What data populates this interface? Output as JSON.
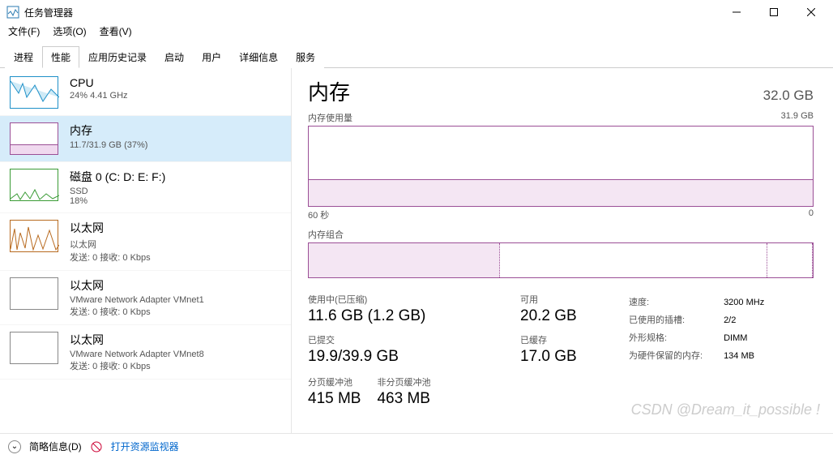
{
  "window": {
    "title": "任务管理器",
    "menu": {
      "file": "文件(F)",
      "options": "选项(O)",
      "view": "查看(V)"
    }
  },
  "tabs": [
    "进程",
    "性能",
    "应用历史记录",
    "启动",
    "用户",
    "详细信息",
    "服务"
  ],
  "activeTab": 1,
  "sidebar": [
    {
      "name": "CPU",
      "sub": "24% 4.41 GHz",
      "color": "#1e90c8"
    },
    {
      "name": "内存",
      "sub": "11.7/31.9 GB (37%)",
      "color": "#9b4f96",
      "selected": true
    },
    {
      "name": "磁盘 0 (C: D: E: F:)",
      "sub": "SSD",
      "sub2": "18%",
      "color": "#3a9b35"
    },
    {
      "name": "以太网",
      "sub": "以太网",
      "sub2": "发送: 0  接收: 0 Kbps",
      "color": "#b86a1f"
    },
    {
      "name": "以太网",
      "sub": "VMware Network Adapter VMnet1",
      "sub2": "发送: 0  接收: 0 Kbps",
      "color": "#888"
    },
    {
      "name": "以太网",
      "sub": "VMware Network Adapter VMnet8",
      "sub2": "发送: 0  接收: 0 Kbps",
      "color": "#888"
    }
  ],
  "main": {
    "title": "内存",
    "capacity": "32.0 GB",
    "usageLabel": "内存使用量",
    "usageMax": "31.9 GB",
    "xLeft": "60 秒",
    "xRight": "0",
    "compLabel": "内存组合",
    "stats": {
      "inUse": {
        "label": "使用中(已压缩)",
        "value": "11.6 GB (1.2 GB)"
      },
      "available": {
        "label": "可用",
        "value": "20.2 GB"
      },
      "committed": {
        "label": "已提交",
        "value": "19.9/39.9 GB"
      },
      "cached": {
        "label": "已缓存",
        "value": "17.0 GB"
      },
      "paged": {
        "label": "分页缓冲池",
        "value": "415 MB"
      },
      "nonpaged": {
        "label": "非分页缓冲池",
        "value": "463 MB"
      }
    },
    "specs": {
      "speed": {
        "label": "速度:",
        "value": "3200 MHz"
      },
      "slots": {
        "label": "已使用的插槽:",
        "value": "2/2"
      },
      "form": {
        "label": "外形规格:",
        "value": "DIMM"
      },
      "reserved": {
        "label": "为硬件保留的内存:",
        "value": "134 MB"
      }
    }
  },
  "footer": {
    "brief": "简略信息(D)",
    "resmon": "打开资源监视器"
  },
  "watermark": "CSDN @Dream_it_possible !",
  "chart_data": {
    "type": "area",
    "title": "内存使用量",
    "xlabel": "秒",
    "ylabel": "GB",
    "x_range": [
      60,
      0
    ],
    "ylim": [
      0,
      31.9
    ],
    "values_estimate": {
      "level_gb": 11.7,
      "percent": 37
    }
  }
}
